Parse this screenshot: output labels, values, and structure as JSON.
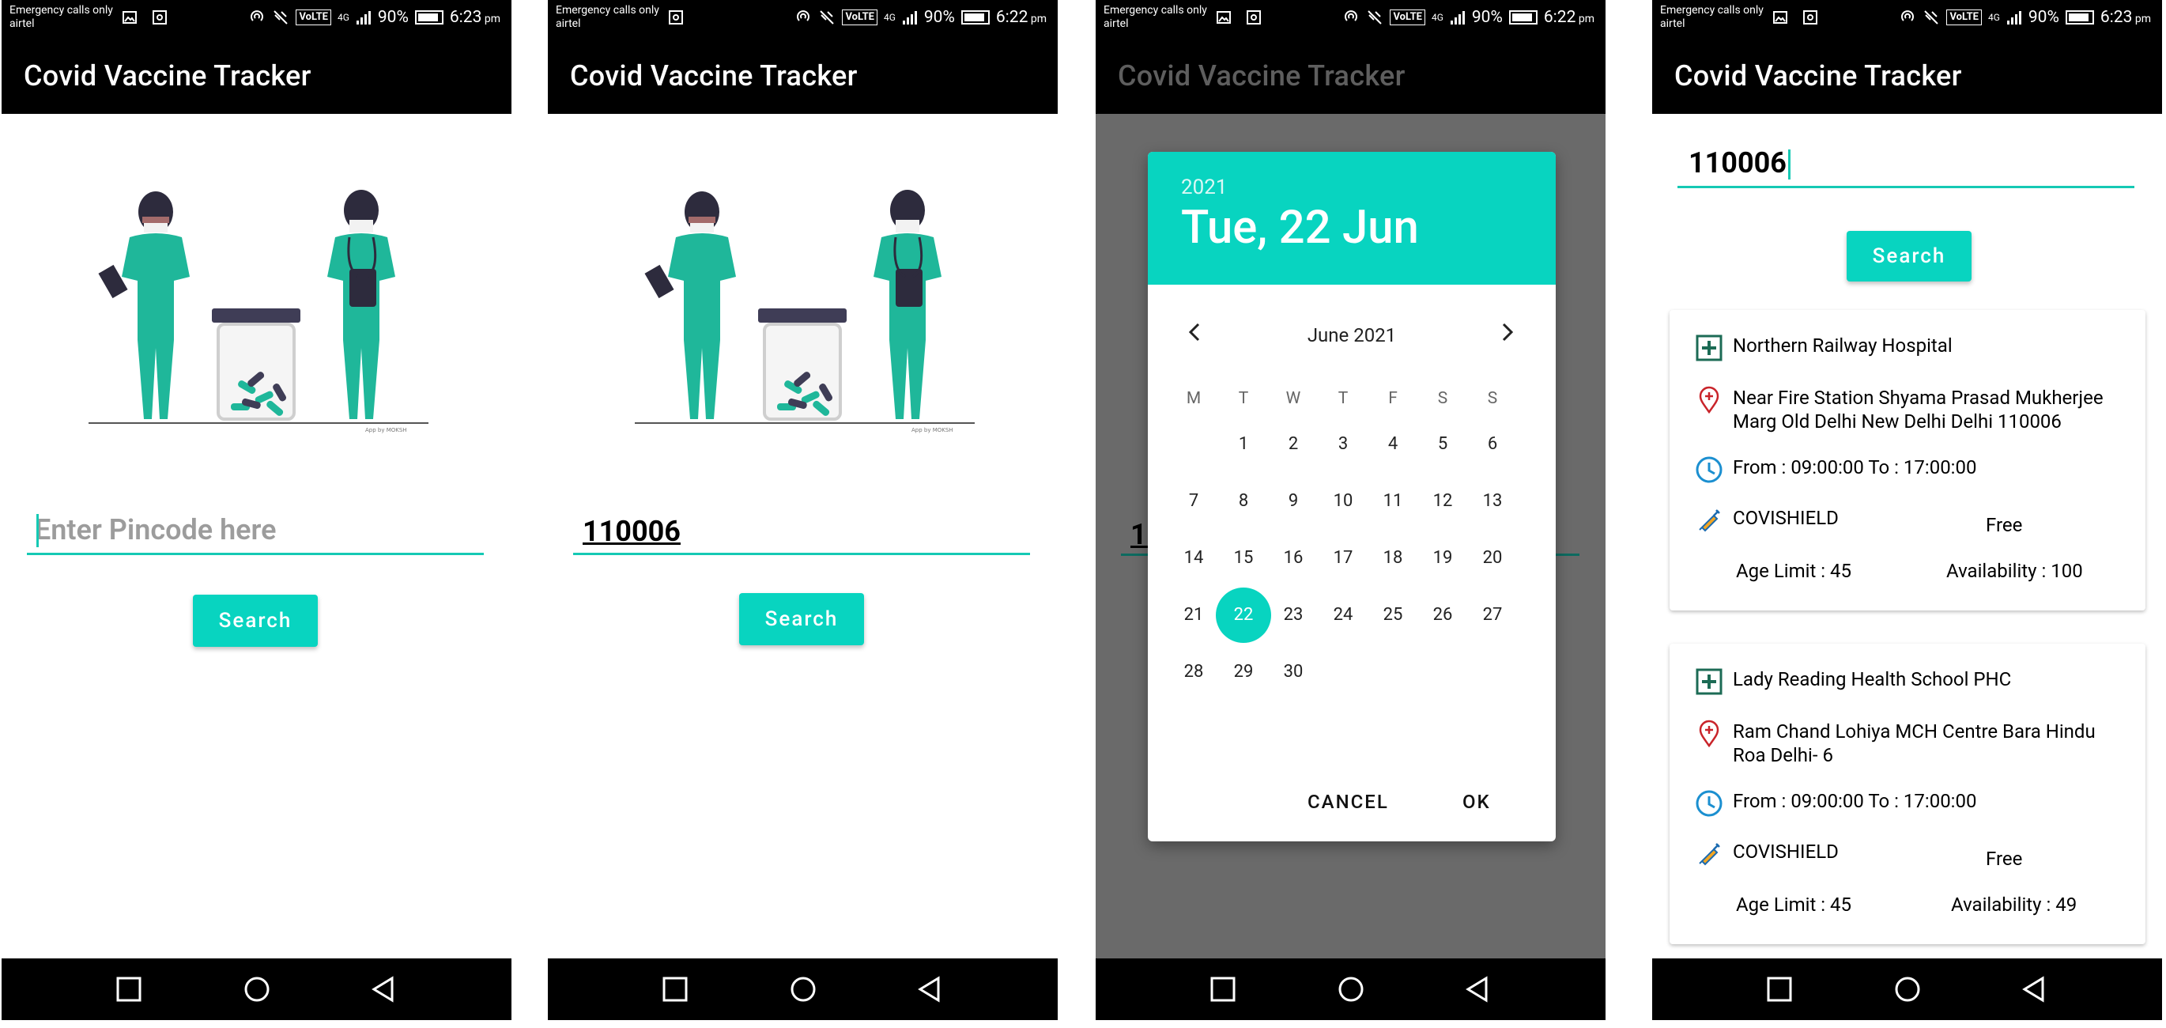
{
  "status": {
    "carrier_line1": "Emergency calls only",
    "carrier_line2": "airtel",
    "network": "4G",
    "battery": "90%",
    "time_a": "6:23",
    "time_b": "6:22",
    "ampm": "pm"
  },
  "app": {
    "title": "Covid Vaccine Tracker",
    "search_label": "Search",
    "pin_placeholder": "Enter Pincode here",
    "pin_value": "110006",
    "illustration_credit": "App by MOKSH"
  },
  "datepicker": {
    "year": "2021",
    "header_date": "Tue, 22 Jun",
    "month_label": "June 2021",
    "weekdays": [
      "M",
      "T",
      "W",
      "T",
      "F",
      "S",
      "S"
    ],
    "weeks": [
      [
        "",
        "1",
        "2",
        "3",
        "4",
        "5",
        "6"
      ],
      [
        "7",
        "8",
        "9",
        "10",
        "11",
        "12",
        "13"
      ],
      [
        "14",
        "15",
        "16",
        "17",
        "18",
        "19",
        "20"
      ],
      [
        "21",
        "22",
        "23",
        "24",
        "25",
        "26",
        "27"
      ],
      [
        "28",
        "29",
        "30",
        "",
        "",
        "",
        ""
      ]
    ],
    "selected": "22",
    "cancel_label": "CANCEL",
    "ok_label": "OK"
  },
  "results": [
    {
      "name": "Northern Railway Hospital",
      "address": "Near Fire Station Shyama Prasad Mukherjee Marg Old Delhi New Delhi Delhi 110006",
      "timing": "From : 09:00:00 To : 17:00:00",
      "vaccine": "COVISHIELD",
      "fee": "Free",
      "age": "Age Limit : 45",
      "availability": "Availability : 100"
    },
    {
      "name": "Lady Reading Health School PHC",
      "address": "Ram Chand Lohiya MCH Centre Bara Hindu Roa Delhi- 6",
      "timing": "From : 09:00:00 To : 17:00:00",
      "vaccine": "COVISHIELD",
      "fee": "Free",
      "age": "Age Limit : 45",
      "availability": "Availability : 49"
    }
  ]
}
